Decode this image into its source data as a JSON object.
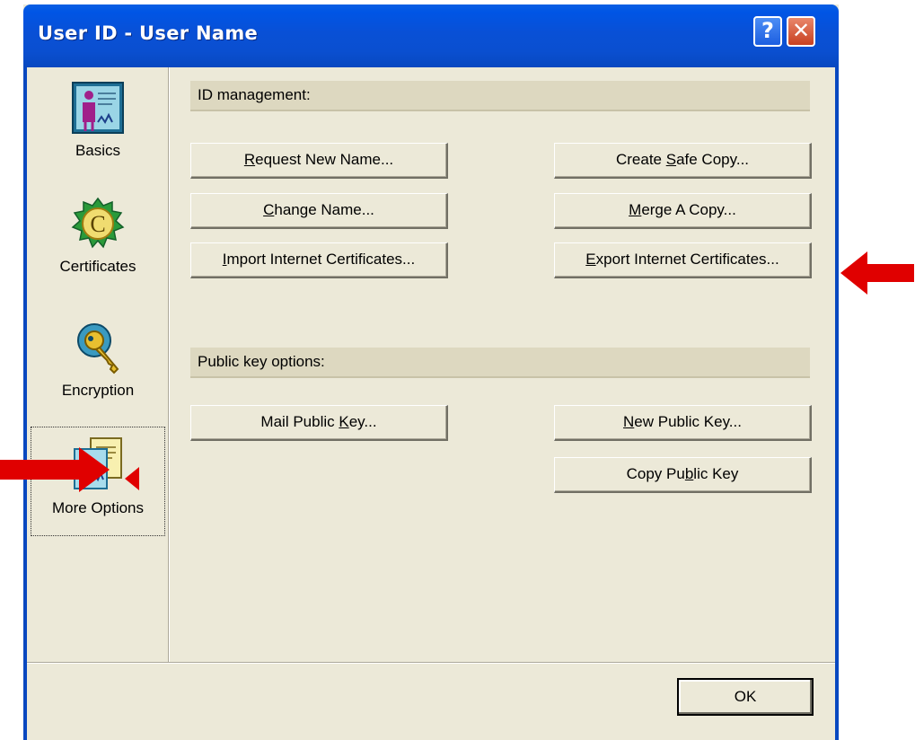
{
  "window": {
    "title_part1": "User ID - ",
    "title_part2": "User Name",
    "help_glyph": "?",
    "close_glyph": "✕"
  },
  "sidebar": {
    "items": [
      {
        "label": "Basics",
        "icon": "id-card-icon"
      },
      {
        "label": "Certificates",
        "icon": "certificate-seal-icon"
      },
      {
        "label": "Encryption",
        "icon": "key-icon"
      },
      {
        "label": "More Options",
        "icon": "more-options-icon",
        "selected": true
      }
    ]
  },
  "sections": {
    "id_management": {
      "header": "ID management:",
      "buttons": {
        "request_new_name": {
          "pre": "",
          "accel": "R",
          "post": "equest New Name..."
        },
        "create_safe_copy": {
          "pre": "Create ",
          "accel": "S",
          "post": "afe Copy..."
        },
        "change_name": {
          "pre": "",
          "accel": "C",
          "post": "hange Name..."
        },
        "merge_a_copy": {
          "pre": "",
          "accel": "M",
          "post": "erge A Copy..."
        },
        "import_internet_certificates": {
          "pre": "",
          "accel": "I",
          "post": "mport Internet Certificates..."
        },
        "export_internet_certificates": {
          "pre": "",
          "accel": "E",
          "post": "xport Internet Certificates..."
        }
      }
    },
    "public_key_options": {
      "header": "Public key options:",
      "buttons": {
        "mail_public_key": {
          "pre": "Mail Public ",
          "accel": "K",
          "post": "ey..."
        },
        "new_public_key": {
          "pre": "",
          "accel": "N",
          "post": "ew Public Key..."
        },
        "copy_public_key": {
          "pre": "Copy Pu",
          "accel": "b",
          "post": "lic Key"
        }
      }
    }
  },
  "footer": {
    "ok_label": "OK"
  },
  "colors": {
    "titlebar": "#0a4fd0",
    "dialog_bg": "#ece9d8",
    "annotation_arrow": "#e00000"
  }
}
